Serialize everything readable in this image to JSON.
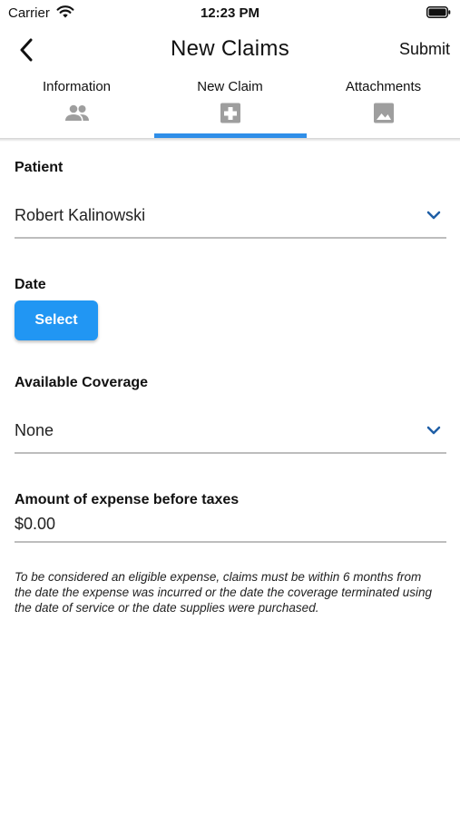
{
  "status_bar": {
    "carrier": "Carrier",
    "time": "12:23 PM"
  },
  "nav": {
    "title": "New Claims",
    "submit_label": "Submit",
    "back_icon": "chevron-left-icon"
  },
  "tabs": [
    {
      "label": "Information",
      "icon": "people-icon",
      "selected": false
    },
    {
      "label": "New Claim",
      "icon": "medical-cross-icon",
      "selected": true
    },
    {
      "label": "Attachments",
      "icon": "image-icon",
      "selected": false
    }
  ],
  "form": {
    "patient": {
      "label": "Patient",
      "value": "Robert Kalinowski"
    },
    "date": {
      "label": "Date",
      "button_label": "Select"
    },
    "coverage": {
      "label": "Available Coverage",
      "value": "None"
    },
    "amount": {
      "label": "Amount of expense before taxes",
      "value": "$0.00"
    }
  },
  "disclaimer": "To be considered an eligible expense, claims must be within 6 months from the date the expense was incurred or the date the coverage terminated using the date of service or the date supplies were purchased.",
  "colors": {
    "accent": "#2196f3",
    "tab_indicator": "#2f8ee8",
    "chevron": "#1f5fa6",
    "tab_icon": "#9e9e9e",
    "underline": "#bdbdbd"
  }
}
